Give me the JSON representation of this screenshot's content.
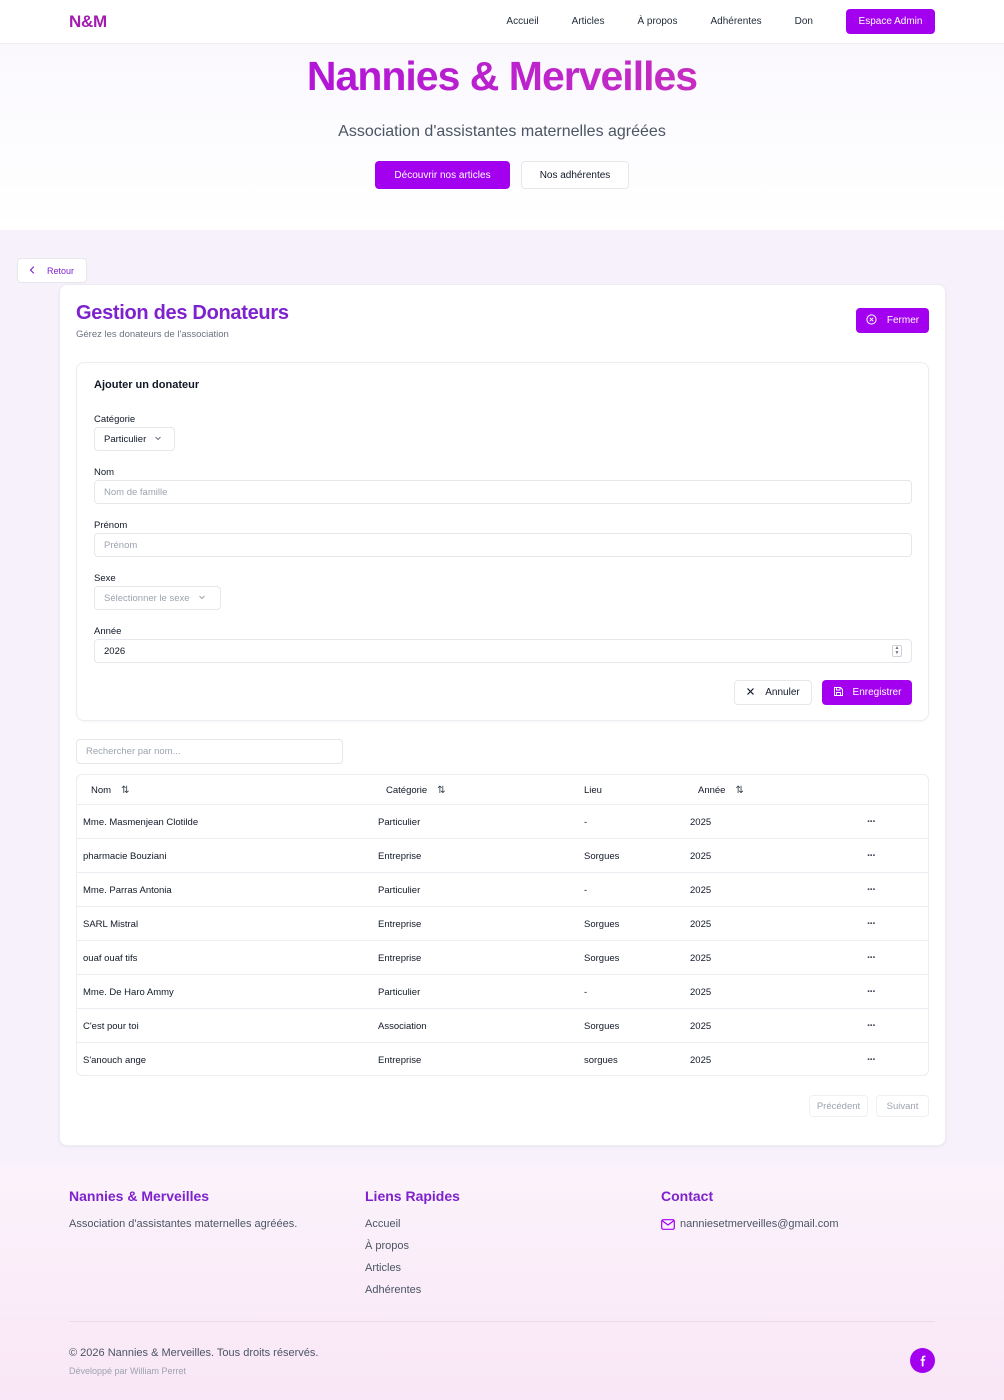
{
  "nav": {
    "logo": "N&M",
    "links": [
      "Accueil",
      "Articles",
      "À propos",
      "Adhérentes",
      "Don"
    ],
    "admin": "Espace Admin"
  },
  "hero": {
    "title": "Nannies & Merveilles",
    "subtitle": "Association d'assistantes maternelles agréées",
    "btn_articles": "Découvrir nos articles",
    "btn_members": "Nos adhérentes"
  },
  "back_label": "Retour",
  "panel": {
    "title": "Gestion des Donateurs",
    "subtitle": "Gérez les donateurs de l'association",
    "close_label": "Fermer"
  },
  "form": {
    "title": "Ajouter un donateur",
    "category_label": "Catégorie",
    "category_value": "Particulier",
    "name_label": "Nom",
    "name_placeholder": "Nom de famille",
    "firstname_label": "Prénom",
    "firstname_placeholder": "Prénom",
    "sex_label": "Sexe",
    "sex_placeholder": "Sélectionner le sexe",
    "year_label": "Année",
    "year_value": "2026",
    "cancel_label": "Annuler",
    "save_label": "Enregistrer"
  },
  "search_placeholder": "Rechercher par nom...",
  "table": {
    "headers": [
      "Nom",
      "Catégorie",
      "Lieu",
      "Année"
    ],
    "rows": [
      {
        "name": "Mme. Masmenjean Clotilde",
        "category": "Particulier",
        "place": "-",
        "year": "2025"
      },
      {
        "name": "pharmacie Bouziani",
        "category": "Entreprise",
        "place": "Sorgues",
        "year": "2025"
      },
      {
        "name": "Mme. Parras Antonia",
        "category": "Particulier",
        "place": "-",
        "year": "2025"
      },
      {
        "name": "SARL Mistral",
        "category": "Entreprise",
        "place": "Sorgues",
        "year": "2025"
      },
      {
        "name": "ouaf ouaf tifs",
        "category": "Entreprise",
        "place": "Sorgues",
        "year": "2025"
      },
      {
        "name": "Mme. De Haro Ammy",
        "category": "Particulier",
        "place": "-",
        "year": "2025"
      },
      {
        "name": "C'est pour toi",
        "category": "Association",
        "place": "Sorgues",
        "year": "2025"
      },
      {
        "name": "S'anouch ange",
        "category": "Entreprise",
        "place": "sorgues",
        "year": "2025"
      }
    ],
    "row_action": "···"
  },
  "pagination": {
    "prev": "Précédent",
    "next": "Suivant"
  },
  "footer": {
    "brand_title": "Nannies & Merveilles",
    "brand_text": "Association d'assistantes maternelles agréées.",
    "links_title": "Liens Rapides",
    "links": [
      "Accueil",
      "À propos",
      "Articles",
      "Adhérentes"
    ],
    "contact_title": "Contact",
    "email": "nanniesetmerveilles@gmail.com",
    "copyright": "© 2026 Nannies & Merveilles. Tous droits réservés.",
    "developer": "Développé par William Perret"
  },
  "colors": {
    "accent": "#a300f0",
    "title_purple": "#7e22ce",
    "logo": "#a21caf"
  }
}
